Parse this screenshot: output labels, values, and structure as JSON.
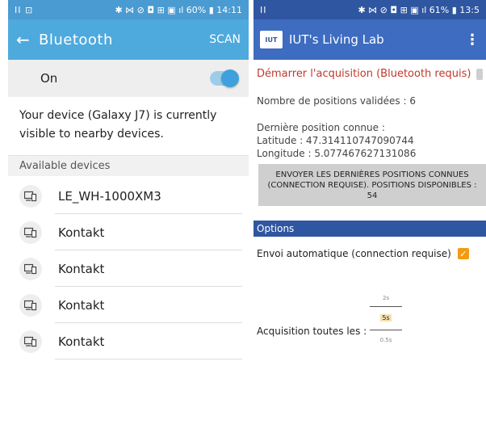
{
  "left": {
    "status": {
      "left": "II ⊡",
      "right": "✱ ⋈ ⊘ ◘ ⊞ ▣ ıl 60% ▮ 14:11"
    },
    "appbar": {
      "back": "←",
      "title": "Bluetooth",
      "scan": "SCAN"
    },
    "on_label": "On",
    "visible_message": "Your device (Galaxy J7) is currently visible to nearby devices.",
    "available_header": "Available devices",
    "devices": [
      "LE_WH-1000XM3",
      "Kontakt",
      "Kontakt",
      "Kontakt",
      "Kontakt"
    ],
    "icons": {
      "back": "arrow-left-icon",
      "device": "device-icon"
    }
  },
  "right": {
    "status": {
      "left": "II",
      "right": "✱ ⋈ ⊘ ◘ ⊞ ▣ ıl 61% ▮ 13:5"
    },
    "appbar": {
      "logo": "IUT",
      "title": "IUT's Living Lab",
      "menu": "⋮"
    },
    "start_acquisition": "Démarrer l'acquisition (Bluetooth requis)",
    "validated_positions": "Nombre de positions validées : 6",
    "last_position": {
      "heading": "Dernière position connue :",
      "latitude": "Latitude : 47.314110747090744",
      "longitude": "Longitude : 5.07746762713108​6"
    },
    "send_button": "ENVOYER LES DERNIÈRES POSITIONS CONNUES (CONNECTION REQUISE). POSITIONS DISPONIBLES : 54",
    "options_header": "Options",
    "auto_send": "Envoi automatique (connection requise)",
    "acquisition_label": "Acquisition toutes les :",
    "picker": {
      "above": "2s",
      "selected": "5s",
      "below": "0.5s"
    },
    "colors": {
      "accent": "#f39c12",
      "primary": "#2f56a0",
      "alert": "#c0392b"
    }
  }
}
